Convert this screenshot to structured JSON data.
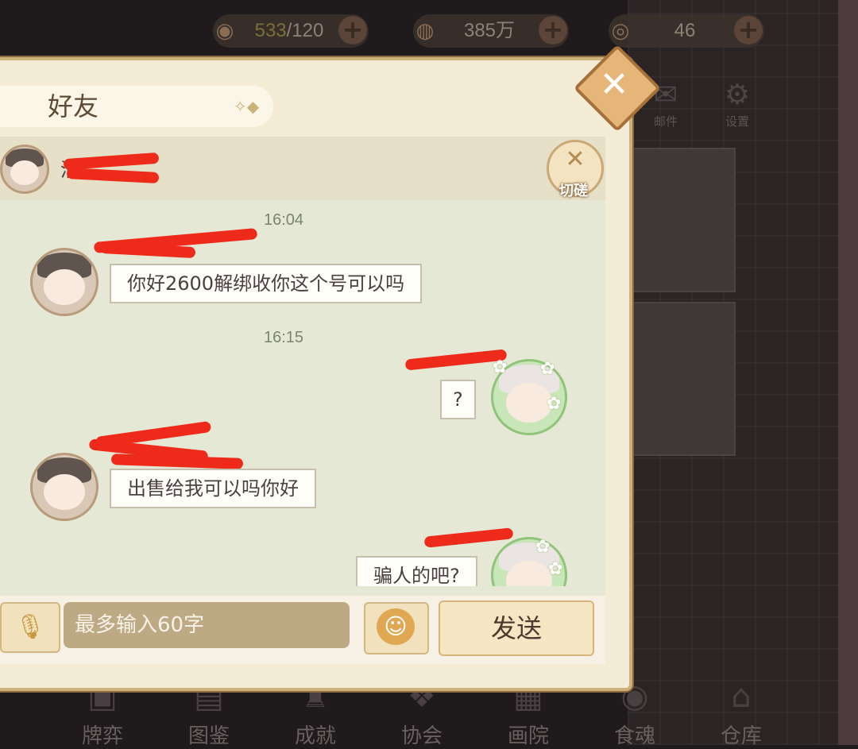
{
  "resources": [
    {
      "icon": "rice-bowl-icon",
      "value_highlight": "533",
      "value_rest": "/120"
    },
    {
      "icon": "coin-icon",
      "value_highlight": "",
      "value_rest": "385万"
    },
    {
      "icon": "jade-icon",
      "value_highlight": "",
      "value_rest": "46"
    }
  ],
  "side": {
    "mail": "邮件",
    "settings": "设置"
  },
  "dialog": {
    "title": "好友",
    "friend_name_visible": "清",
    "spar_label": "切磋",
    "input_placeholder": "最多输入60字",
    "send_label": "发送"
  },
  "messages": [
    {
      "time": "16:04"
    },
    {
      "text": "你好2600解绑收你这个号可以吗",
      "side": "left"
    },
    {
      "time": "16:15"
    },
    {
      "text": "?",
      "side": "right"
    },
    {
      "text": "出售给我可以吗你好",
      "side": "left"
    },
    {
      "text": "骗人的吧?",
      "side": "right"
    }
  ],
  "bottom_nav": [
    "牌弈",
    "图鉴",
    "成就",
    "协会",
    "画院",
    "食魂",
    "仓库"
  ],
  "colors": {
    "accent": "#cdb27e",
    "redaction": "#ee2a1a",
    "send_bg": "#f6e7c4"
  }
}
